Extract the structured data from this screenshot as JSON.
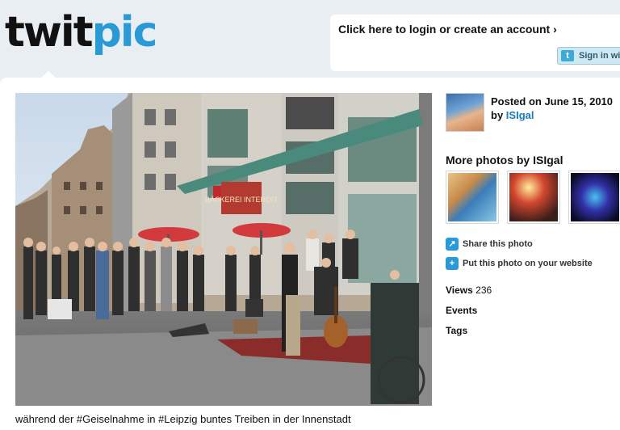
{
  "header": {
    "logo_part1": "twit",
    "logo_part2": "pic",
    "login_link": "Click here to login or create an account ›",
    "signin_label": "Sign in with"
  },
  "photo": {
    "caption": "während der #Geiselnahme in #Leipzig buntes Treiben in der Innenstadt",
    "sign_text": "BÄCKEREI INTEROIT"
  },
  "sidebar": {
    "posted_on": "Posted on June 15, 2010",
    "by_label": "by",
    "username": "ISIgal",
    "more_photos": "More photos by ISIgal",
    "share_label": "Share this photo",
    "put_label": "Put this photo on your website",
    "views_label": "Views",
    "views_count": "236",
    "events_label": "Events",
    "tags_label": "Tags"
  },
  "icons": {
    "share": "share-icon",
    "put": "plus-icon",
    "twitter": "twitter-bird-icon"
  },
  "colors": {
    "brand_blue": "#2a9ad6",
    "link_blue": "#1a7bbd",
    "page_bg": "#e9eef3"
  }
}
